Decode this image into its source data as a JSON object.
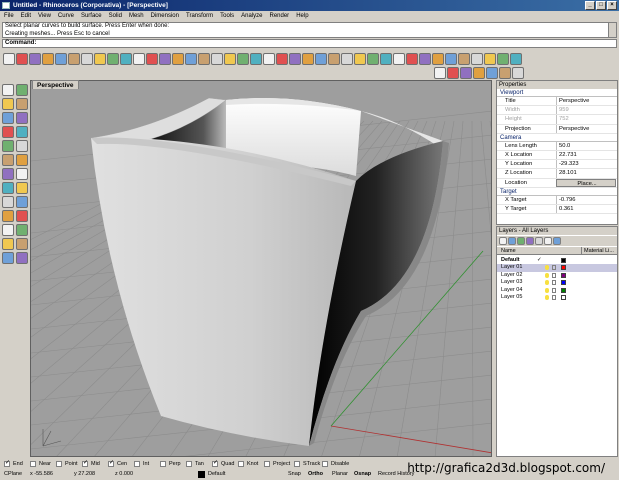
{
  "window": {
    "title": "Untitled - Rhinoceros (Corporativa) - [Perspective]",
    "btn_min": "_",
    "btn_max": "□",
    "btn_close": "×"
  },
  "menu": [
    "File",
    "Edit",
    "View",
    "Curve",
    "Surface",
    "Solid",
    "Mesh",
    "Dimension",
    "Transform",
    "Tools",
    "Analyze",
    "Render",
    "Help"
  ],
  "command": {
    "history": [
      "Select planar curves to build surface. Press Enter when done:",
      "Creating meshes... Press Esc to cancel"
    ],
    "prompt": "Command:"
  },
  "viewport": {
    "label": "Perspective"
  },
  "properties": {
    "header": "Properties",
    "viewport_section": "Viewport",
    "rows1": [
      {
        "k": "Title",
        "v": "Perspective",
        "dis": false
      },
      {
        "k": "Width",
        "v": "959",
        "dis": true
      },
      {
        "k": "Height",
        "v": "752",
        "dis": true
      },
      {
        "k": "Projection",
        "v": "Perspective",
        "dis": false
      }
    ],
    "camera_section": "Camera",
    "rows2": [
      {
        "k": "Lens Length",
        "v": "50.0"
      },
      {
        "k": "X Location",
        "v": "22.731"
      },
      {
        "k": "Y Location",
        "v": "-29.323"
      },
      {
        "k": "Z Location",
        "v": "28.101"
      },
      {
        "k": "Location",
        "v": "Place..."
      }
    ],
    "target_section": "Target",
    "rows3": [
      {
        "k": "X Target",
        "v": "-0.796"
      },
      {
        "k": "Y Target",
        "v": "0.361"
      }
    ]
  },
  "layers": {
    "header": "Layers - All Layers",
    "col_name": "Name",
    "col_material": "Material Li...",
    "rows": [
      {
        "name": "Default",
        "chk": "✓",
        "color": "#000000",
        "bold": true
      },
      {
        "name": "Layer 01",
        "chk": "",
        "color": "#ff0000",
        "bold": false
      },
      {
        "name": "Layer 02",
        "chk": "",
        "color": "#800080",
        "bold": false
      },
      {
        "name": "Layer 03",
        "chk": "",
        "color": "#0000ff",
        "bold": false
      },
      {
        "name": "Layer 04",
        "chk": "",
        "color": "#008000",
        "bold": false
      },
      {
        "name": "Layer 05",
        "chk": "",
        "color": "#ffffff",
        "bold": false
      }
    ]
  },
  "osnap": [
    {
      "label": "End",
      "on": true
    },
    {
      "label": "Near",
      "on": false
    },
    {
      "label": "Point",
      "on": false
    },
    {
      "label": "Mid",
      "on": true
    },
    {
      "label": "Cen",
      "on": true
    },
    {
      "label": "Int",
      "on": false
    },
    {
      "label": "Perp",
      "on": false
    },
    {
      "label": "Tan",
      "on": false
    },
    {
      "label": "Quad",
      "on": true
    },
    {
      "label": "Knot",
      "on": false
    },
    {
      "label": "Project",
      "on": false
    },
    {
      "label": "STrack",
      "on": false
    },
    {
      "label": "Disable",
      "on": false
    }
  ],
  "status": {
    "cplane": "CPlane",
    "x": "x -55.586",
    "y": "y 27.208",
    "z": "z 0.000",
    "layer": "Default",
    "snap": "Snap",
    "ortho": "Ortho",
    "planar": "Planar",
    "osnap": "Osnap",
    "record": "Record History"
  },
  "watermark": "http://grafica2d3d.blogspot.com/",
  "colors": {
    "title_bar": "#0a246a",
    "viewport_bg": "#9e9e9e",
    "grid": "#8a8a8a"
  }
}
